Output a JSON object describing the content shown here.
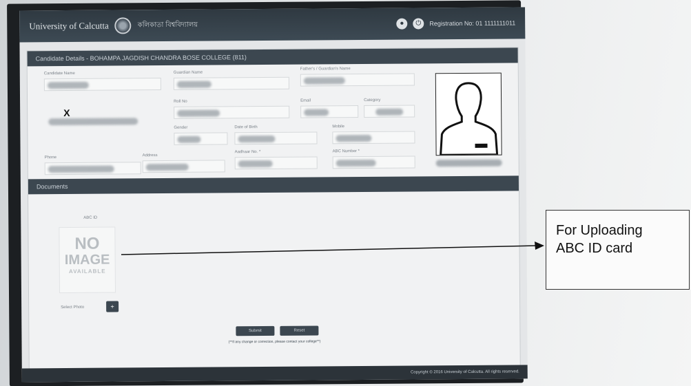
{
  "header": {
    "brand": "University of Calcutta",
    "brand_local": "কলিকাতা বিশ্ববিদ্যালয়",
    "registration_label": "Registration No: 01 1111111011"
  },
  "candidate": {
    "section_title": "Candidate Details - BOHAMPA JAGDISH CHANDRA BOSE COLLEGE (811)",
    "fields": [
      "Candidate Name",
      "Guardian Name",
      "Father's / Guardian's Name",
      "Roll No",
      "Email",
      "Category",
      "Gender",
      "Date of Birth",
      "Mobile",
      "Phone",
      "Address",
      "Aadhaar No. *",
      "ABC Number *"
    ],
    "x_mark": "X"
  },
  "documents": {
    "section_title": "Documents",
    "photo_label": "ABC ID",
    "no_image": [
      "NO",
      "IMAGE",
      "AVAILABLE"
    ],
    "select_photo_label": "Select Photo",
    "select_button": "+"
  },
  "actions": {
    "submit": "Submit",
    "reset": "Reset",
    "note": "(**If any change or correction, please contact your college**)"
  },
  "footer": {
    "copyright": "Copyright © 2016 University of Calcutta. All rights reserved."
  },
  "annotation": {
    "line1": "For Uploading",
    "line2": "ABC ID card"
  },
  "icons": [
    "seal-icon",
    "globe-icon",
    "power-icon",
    "user-silhouette-icon",
    "arrow-icon"
  ]
}
